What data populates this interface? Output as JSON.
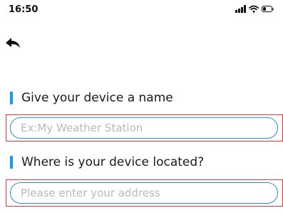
{
  "status_bar": {
    "time": "16:50",
    "icons": [
      "signal-icon",
      "wifi-icon",
      "battery-icon"
    ]
  },
  "navigation": {
    "back_icon": "back-arrow-icon"
  },
  "form": {
    "name_section": {
      "label": "Give your device a name",
      "placeholder": "Ex:My Weather Station",
      "value": ""
    },
    "location_section": {
      "label": "Where is your device located?",
      "placeholder": "Please enter your address",
      "value": ""
    }
  },
  "colors": {
    "accent": "#2196e8",
    "input_border": "#2b8fd6",
    "highlight_frame": "#e0393b",
    "placeholder": "#b9b9b9"
  }
}
